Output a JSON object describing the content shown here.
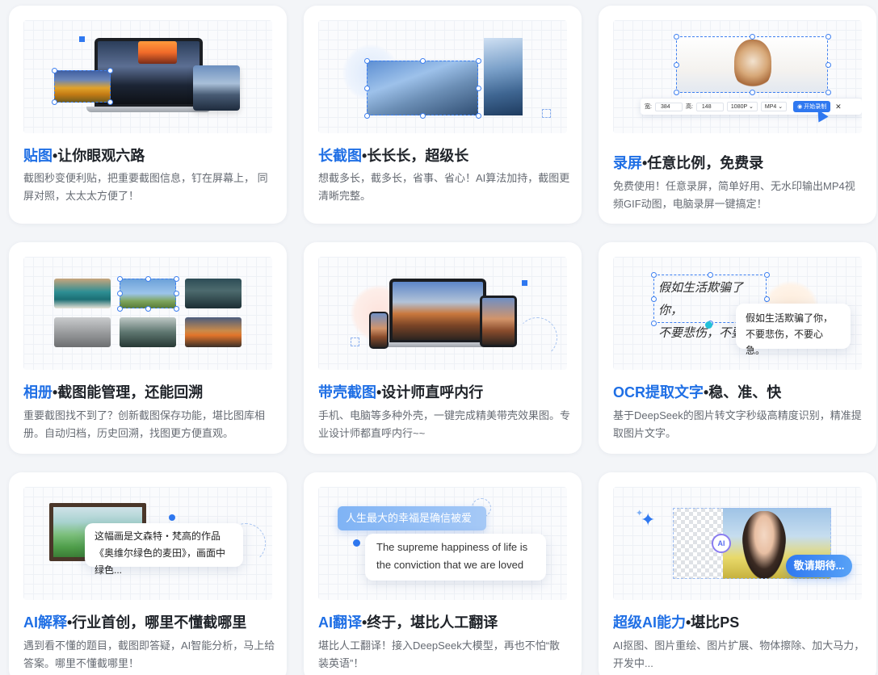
{
  "cards": [
    {
      "title_hl": "贴图",
      "title_rest": "•让你眼观六路",
      "desc": "截图秒变便利贴，把重要截图信息，钉在屏幕上， 同屏对照，太太太方便了！"
    },
    {
      "title_hl": "长截图",
      "title_rest": "•长长长，超级长",
      "desc": "想截多长，截多长，省事、省心！AI算法加持，截图更清晰完整。"
    },
    {
      "title_hl": "录屏",
      "title_rest": "•任意比例，免费录",
      "desc": "免费使用！任意录屏，简单好用、无水印输出MP4视频GIF动图，电脑录屏一键搞定！"
    },
    {
      "title_hl": "相册",
      "title_rest": "•截图能管理，还能回溯",
      "desc": "重要截图找不到了？创新截图保存功能，堪比图库相册。自动归档，历史回溯，找图更方便直观。"
    },
    {
      "title_hl": "带壳截图",
      "title_rest": "•设计师直呼内行",
      "desc": "手机、电脑等多种外壳，一键完成精美带壳效果图。专业设计师都直呼内行~~"
    },
    {
      "title_hl": "OCR提取文字",
      "title_rest": "•稳、准、快",
      "desc": "基于DeepSeek的图片转文字秒级高精度识别，精准提取图片文字。"
    },
    {
      "title_hl": "AI解释",
      "title_rest": "•行业首创，哪里不懂截哪里",
      "desc": "遇到看不懂的题目，截图即答疑，AI智能分析，马上给答案。哪里不懂截哪里！"
    },
    {
      "title_hl": "AI翻译",
      "title_rest": "•终于，堪比人工翻译",
      "desc": "堪比人工翻译！接入DeepSeek大模型，再也不怕“散装英语”！"
    },
    {
      "title_hl": "超级AI能力",
      "title_rest": "•堪比PS",
      "desc": "AI抠图、图片重绘、图片扩展、物体擦除、加大马力，开发中..."
    }
  ],
  "record_toolbar": {
    "width_label": "宽:",
    "width_value": "384",
    "height_label": "高:",
    "height_value": "148",
    "resolution": "1080P",
    "format": "MP4",
    "record_button": "开始录制"
  },
  "ocr": {
    "handwriting_line1": "假如生活欺骗了你，",
    "handwriting_line2": "不要悲伤，不要心",
    "result_line1": "假如生活欺骗了你，",
    "result_line2": "不要悲伤，不要心急。"
  },
  "ai_explain": {
    "bubble": "这幅画是文森特・梵高的作品《奥维尔绿色的麦田》，画面中绿色..."
  },
  "ai_translate": {
    "source": "人生最大的幸福是确信被爱",
    "target": "The supreme happiness of life is the conviction that we are loved"
  },
  "ai_super": {
    "badge": "AI",
    "coming_soon": "敬请期待..."
  }
}
